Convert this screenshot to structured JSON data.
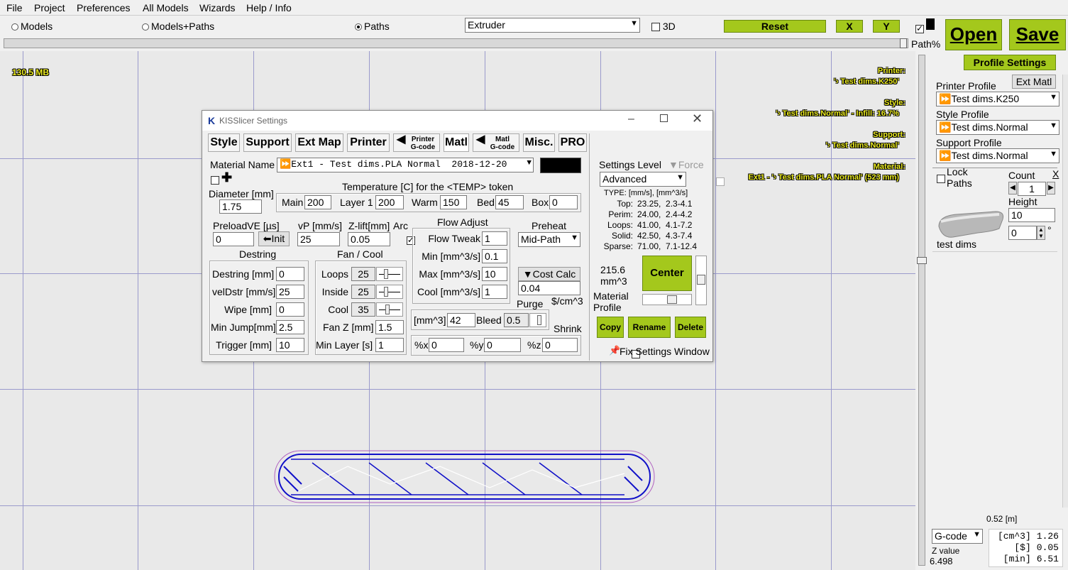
{
  "menu": [
    "File",
    "Project",
    "Preferences",
    "All Models",
    "Wizards",
    "Help / Info"
  ],
  "view_modes": [
    "Models",
    "Models+Paths",
    "Paths"
  ],
  "selected_view": "Paths",
  "extruder_select": "Extruder",
  "three_d_label": "3D",
  "reset_label": "Reset",
  "x_label": "X",
  "y_label": "Y",
  "open_label": "Open",
  "save_label": "Save",
  "path_pct_label": "Path%",
  "memory": "130.5 MB",
  "overlay": {
    "printer_label": "Printer:",
    "printer_value": "'› Test dims.K250'",
    "style_label": "Style:",
    "style_value": "'› Test dims.Normal' - Infill: 16.7%",
    "support_label": "Support:",
    "support_value": "'› Test dims.Normal'",
    "material_label": "Material:",
    "material_value": "Ext1 - '› Test dims.PLA Normal' (523 mm)"
  },
  "dialog": {
    "title": "KISSlicer Settings",
    "tabs": [
      "Style",
      "Support",
      "Ext Map",
      "Printer",
      "Matl",
      "Misc.",
      "PRO"
    ],
    "printer_gcode": [
      "Printer",
      "G-code"
    ],
    "matl_gcode": [
      "Matl",
      "G-code"
    ],
    "material_name_label": "Material Name",
    "material_name_value": "Ext1 - Test dims.PLA Normal  2018-12-20",
    "diameter_label": "Diameter [mm]",
    "diameter_value": "1.75",
    "temp_title": "Temperature [C] for the <TEMP> token",
    "temps": [
      {
        "label": "Main",
        "value": "200"
      },
      {
        "label": "Layer 1",
        "value": "200"
      },
      {
        "label": "Warm",
        "value": "150"
      },
      {
        "label": "Bed",
        "value": "45"
      },
      {
        "label": "Box",
        "value": "0"
      }
    ],
    "preload_label": "PreloadVE [µs]",
    "preload_value": "0",
    "init_label": "Init",
    "vp_label": "vP [mm/s]",
    "vp_value": "25",
    "zlift_label": "Z-lift[mm]",
    "zlift_value": "0.05",
    "arc_label": "Arc",
    "destring_title": "Destring",
    "destring": [
      {
        "label": "Destring [mm]",
        "value": "0"
      },
      {
        "label": "velDstr [mm/s]",
        "value": "25"
      },
      {
        "label": "Wipe [mm]",
        "value": "0"
      },
      {
        "label": "Min Jump[mm]",
        "value": "2.5"
      },
      {
        "label": "Trigger [mm]",
        "value": "10"
      }
    ],
    "fan_title": "Fan / Cool",
    "fans": [
      {
        "label": "Loops",
        "value": "25"
      },
      {
        "label": "Inside",
        "value": "25"
      },
      {
        "label": "Cool",
        "value": "35"
      }
    ],
    "fanz_label": "Fan Z [mm]",
    "fanz_value": "1.5",
    "minlayer_label": "Min Layer [s]",
    "minlayer_value": "1",
    "flow_title": "Flow Adjust",
    "flow": [
      {
        "label": "Flow Tweak",
        "value": "1"
      },
      {
        "label": "Min [mm^3/s]",
        "value": "0.1"
      },
      {
        "label": "Max [mm^3/s]",
        "value": "10"
      },
      {
        "label": "Cool [mm^3/s]",
        "value": "1"
      }
    ],
    "preheat_label": "Preheat",
    "preheat_value": "Mid-Path",
    "costcalc_label": "Cost Calc",
    "cost_value": "0.04",
    "cost_unit": "$/cm^3",
    "purge_label": "Purge",
    "purge_mm3_label": "[mm^3]",
    "purge_value": "42",
    "bleed_label": "Bleed",
    "bleed_value": "0.5",
    "shrink_label": "Shrink",
    "shrink": [
      {
        "label": "%x",
        "value": "0"
      },
      {
        "label": "%y",
        "value": "0"
      },
      {
        "label": "%z",
        "value": "0"
      }
    ],
    "settings_level_label": "Settings Level",
    "force_label": "Force",
    "settings_level_value": "Advanced",
    "type_header": "TYPE: [mm/s], [mm^3/s]",
    "types": [
      {
        "name": "Top:",
        "v": "23.25,  2.3-4.1"
      },
      {
        "name": "Perim:",
        "v": "24.00,  2.4-4.2"
      },
      {
        "name": "Loops:",
        "v": "41.00,  4.1-7.2"
      },
      {
        "name": "Solid:",
        "v": "42.50,  4.3-7.4"
      },
      {
        "name": "Sparse:",
        "v": "71.00,  7.1-12.4"
      }
    ],
    "volume": "215.6",
    "volume_unit": "mm^3",
    "center_label": "Center",
    "material_profile_label": "Material Profile",
    "copy_label": "Copy",
    "rename_label": "Rename",
    "delete_label": "Delete",
    "fix_window_label": "Fix Settings Window"
  },
  "right": {
    "profile_settings": "Profile Settings",
    "ext_matl": "Ext Matl",
    "printer_profile_label": "Printer Profile",
    "printer_profile_value": "Test dims.K250",
    "style_profile_label": "Style Profile",
    "style_profile_value": "Test dims.Normal",
    "support_profile_label": "Support Profile",
    "support_profile_value": "Test dims.Normal",
    "lock_paths_label": "Lock Paths",
    "count_label": "Count",
    "count_x": "X",
    "count_value": "1",
    "height_label": "Height",
    "height_value": "10",
    "rotate_value": "0",
    "degree": "°",
    "model_name": "test dims",
    "length_label": "0.52 [m]",
    "gcode_select": "G-code",
    "zvalue_label": "Z value",
    "zvalue": "6.498",
    "stats": [
      {
        "label": "[cm^3]",
        "value": "1.26"
      },
      {
        "label": "[$]",
        "value": "0.05"
      },
      {
        "label": "[min]",
        "value": "6.51"
      }
    ]
  }
}
